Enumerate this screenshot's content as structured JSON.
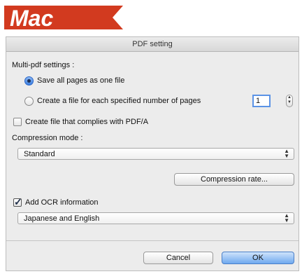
{
  "brand": {
    "label": "Mac",
    "color": "#d23a1f"
  },
  "window": {
    "title": "PDF setting"
  },
  "multi_pdf": {
    "heading": "Multi-pdf settings :",
    "option_all_pages": "Save all pages as one file",
    "option_per_pages": "Create a file for each specified number of pages",
    "selected": "option_all_pages",
    "pages_value": "1"
  },
  "pdfa": {
    "label": "Create file that complies with PDF/A",
    "checked": false
  },
  "compression": {
    "heading": "Compression mode :",
    "selected": "Standard",
    "rate_button": "Compression rate..."
  },
  "ocr": {
    "label": "Add OCR information",
    "checked": true,
    "language": "Japanese and English"
  },
  "footer": {
    "cancel_label": "Cancel",
    "ok_label": "OK"
  },
  "icons": {
    "stepper": "up-down-stepper-icon",
    "popup": "popup-arrows-icon",
    "check": "checkmark-icon"
  }
}
